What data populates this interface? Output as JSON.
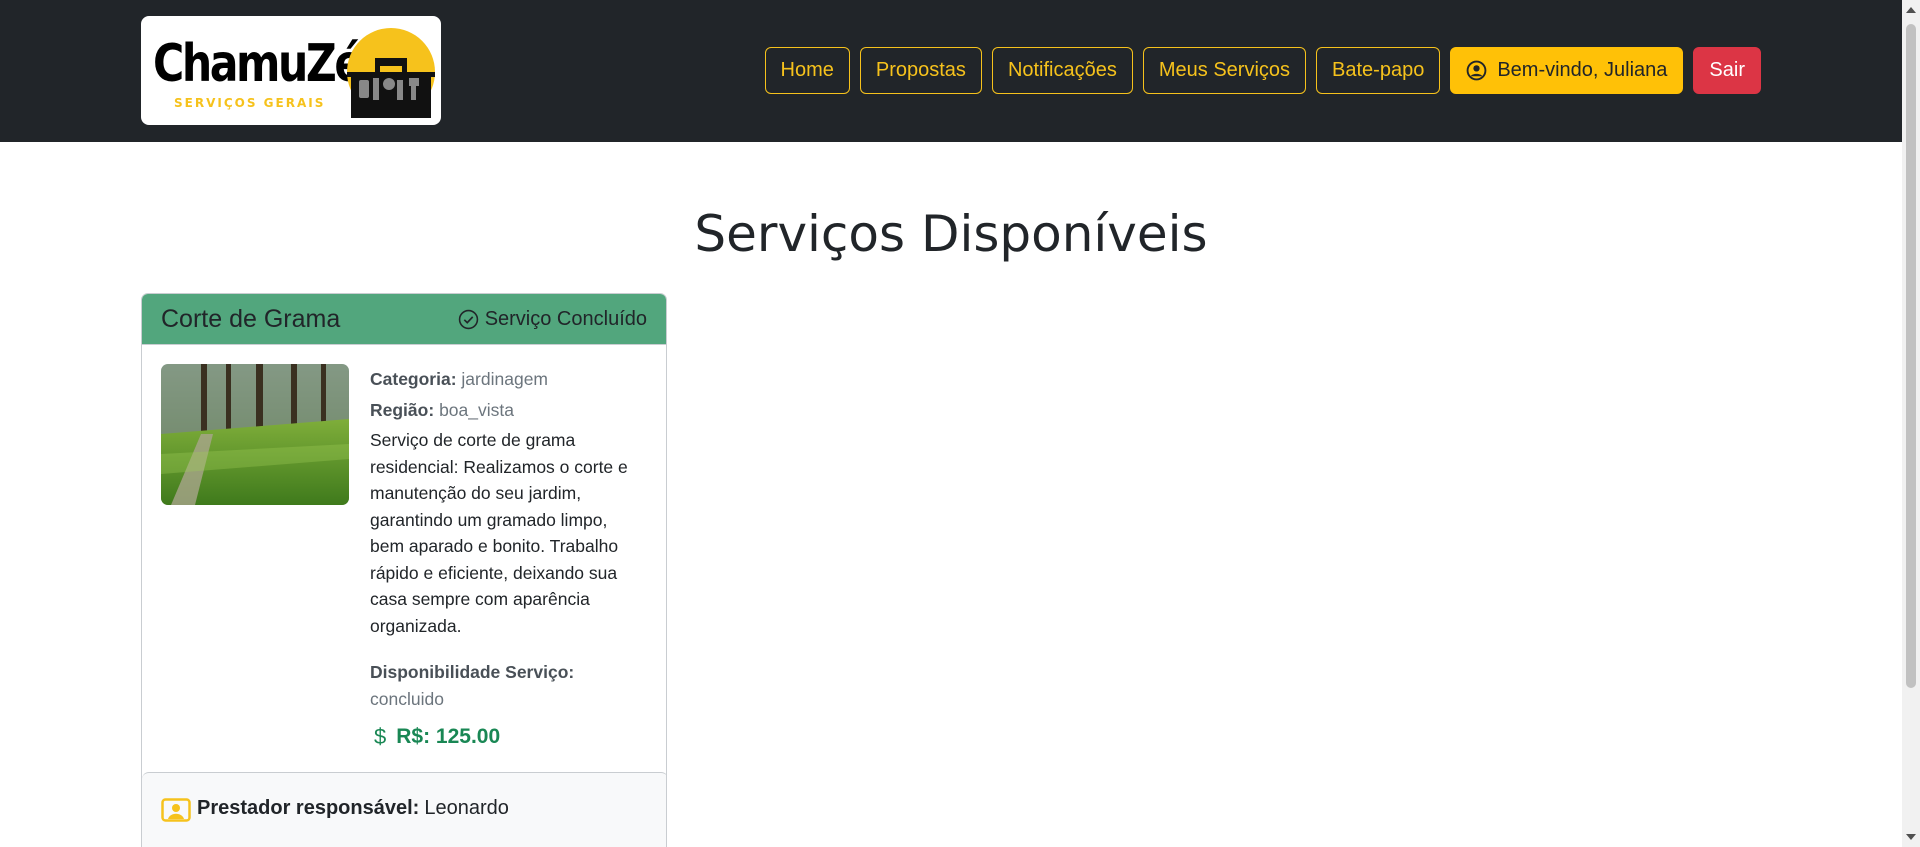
{
  "header": {
    "logo": {
      "wordmark": "ChamuZé",
      "tagline": "SERVIÇOS GERAIS",
      "icon": "toolbox-logo"
    },
    "nav": [
      {
        "label": "Home"
      },
      {
        "label": "Propostas"
      },
      {
        "label": "Notificações"
      },
      {
        "label": "Meus Serviços"
      },
      {
        "label": "Bate-papo"
      }
    ],
    "welcome_label": "Bem-vindo, Juliana",
    "welcome_icon": "user-circle-icon",
    "logout_label": "Sair"
  },
  "main": {
    "title": "Serviços Disponíveis",
    "services": [
      {
        "title": "Corte de Grama",
        "status": "Serviço Concluído",
        "status_icon": "check-circle-icon",
        "image": "grass-photo",
        "category_label": "Categoria:",
        "category": "jardinagem",
        "region_label": "Região:",
        "region": "boa_vista",
        "description": "Serviço de corte de grama residencial: Realizamos o corte e manutenção do seu jardim, garantindo um gramado limpo, bem aparado e bonito. Trabalho rápido e eficiente, deixando sua casa sempre com aparência organizada.",
        "availability_label": "Disponibilidade Serviço:",
        "availability": "concluido",
        "price_icon": "dollar-icon",
        "price": "R$: 125.00",
        "provider_icon": "person-badge-icon",
        "provider_label": "Prestador responsável:",
        "provider": "Leonardo"
      }
    ]
  },
  "colors": {
    "navbar": "#212529",
    "accent": "#ffc107",
    "danger": "#dc3545",
    "card_header": "#52a67d",
    "price": "#198754"
  }
}
